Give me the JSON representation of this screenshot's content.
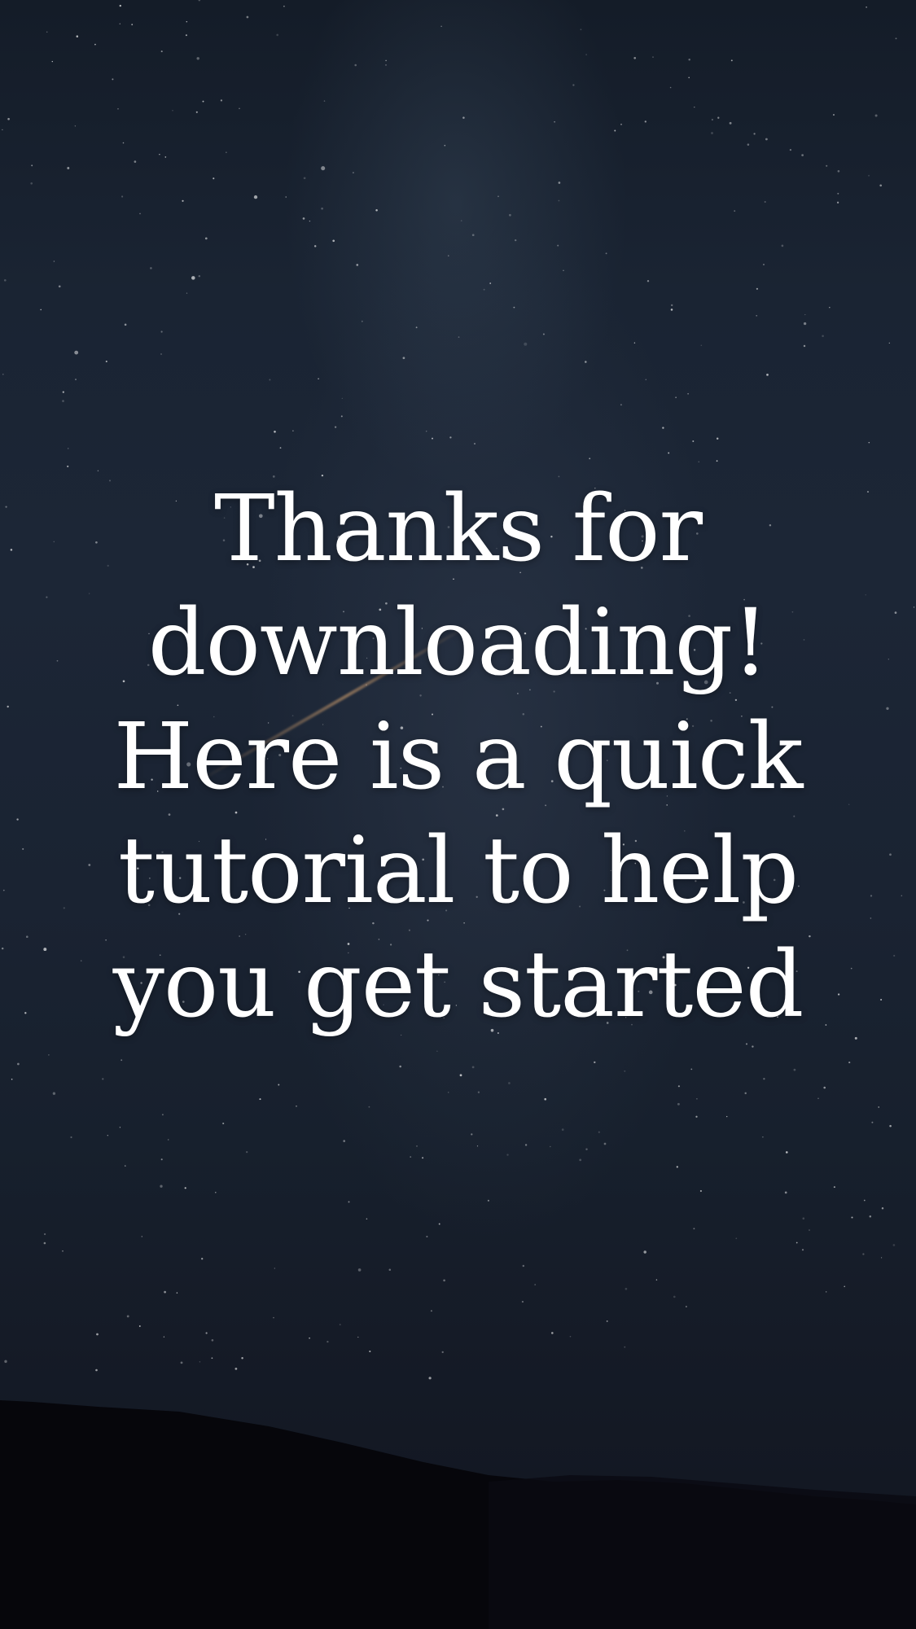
{
  "welcome": {
    "lines": [
      "Thanks for",
      "downloading!",
      "Here is a quick",
      "tutorial to help",
      "you get started"
    ]
  },
  "colors": {
    "text": "#ffffff",
    "sky_top": "#141c28",
    "sky_bottom": "#11151f",
    "hills": "#07070d"
  }
}
